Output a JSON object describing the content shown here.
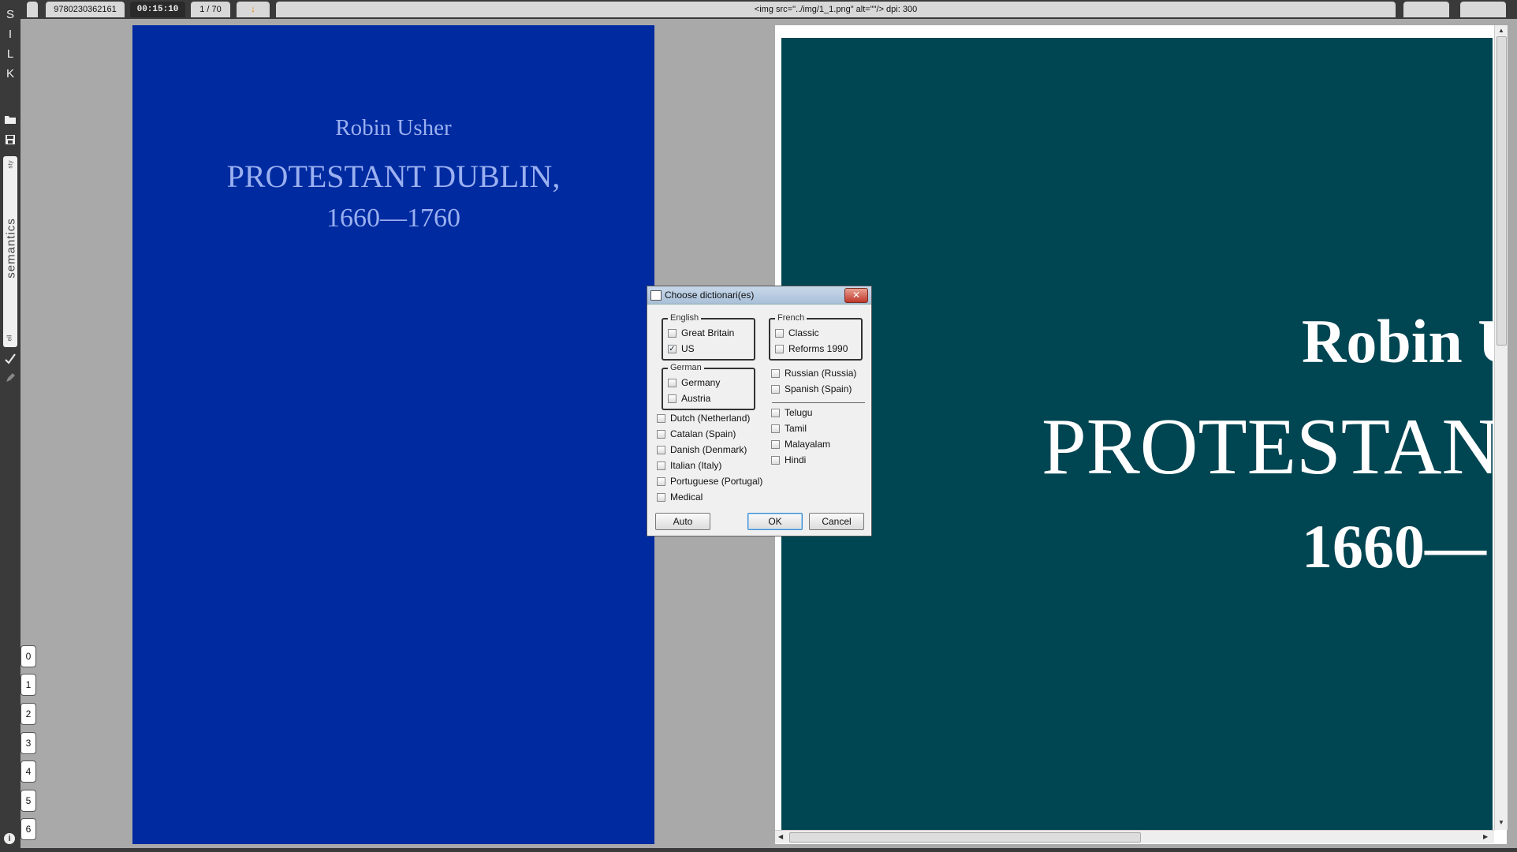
{
  "topbar": {
    "isbn": "9780230362161",
    "timer": "00:15:10",
    "page_counter": "1 / 70",
    "marker": "↓",
    "image_info": "<img src=\"../img/1_1.png\" alt=\"\"/>    dpi: 300"
  },
  "sidebar": {
    "logo_letters": [
      "S",
      "I",
      "L",
      "K"
    ],
    "semantics_label": "semantics",
    "small_top": "sty",
    "small_bottom": "ell",
    "numbers": [
      "0",
      "1",
      "2",
      "3",
      "4",
      "5",
      "6"
    ],
    "info_icon": "i"
  },
  "page": {
    "author": "Robin Usher",
    "title": "PROTESTANT DUBLIN,",
    "years": "1660—1760"
  },
  "zoom": {
    "author": "Robin U",
    "title": "PROTESTAN",
    "years": "1660—"
  },
  "dialog": {
    "title": "Choose dictionari(es)",
    "english_label": "English",
    "english_options": [
      {
        "label": "Great Britain",
        "checked": false
      },
      {
        "label": "US",
        "checked": true
      }
    ],
    "german_label": "German",
    "german_options": [
      {
        "label": "Germany",
        "checked": false
      },
      {
        "label": "Austria",
        "checked": false
      }
    ],
    "french_label": "French",
    "french_options": [
      {
        "label": "Classic",
        "checked": false
      },
      {
        "label": "Reforms 1990",
        "checked": false
      }
    ],
    "left_list": [
      "Dutch (Netherland)",
      "Catalan (Spain)",
      "Danish (Denmark)",
      "Italian (Italy)",
      "Portuguese (Portugal)",
      "Medical"
    ],
    "right_list_top": [
      "Russian (Russia)",
      "Spanish (Spain)"
    ],
    "right_list_bottom": [
      "Telugu",
      "Tamil",
      "Malayalam",
      "Hindi"
    ],
    "buttons": {
      "auto": "Auto",
      "ok": "OK",
      "cancel": "Cancel"
    }
  },
  "colors": {
    "cover_blue": "#002aa0",
    "zoom_teal": "#004552",
    "cover_text": "#9ab0f0"
  }
}
